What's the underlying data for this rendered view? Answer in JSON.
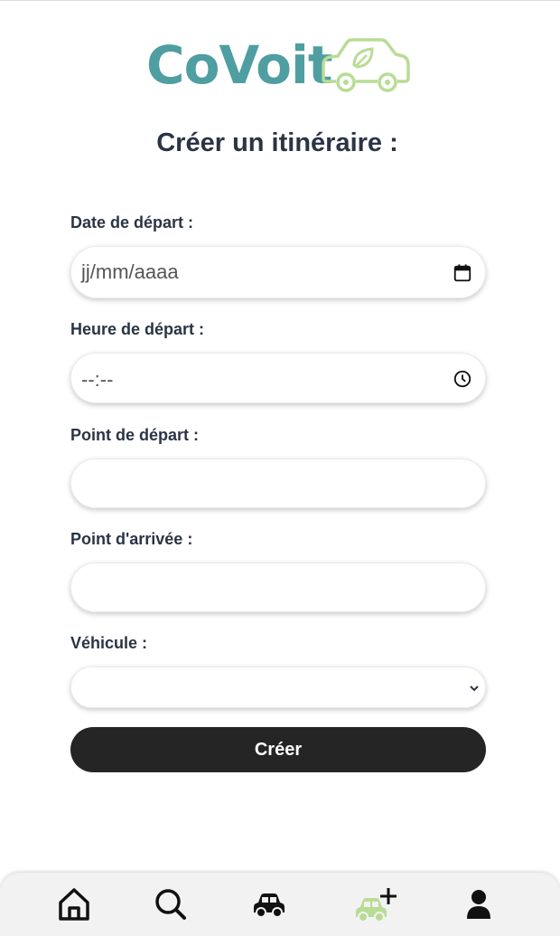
{
  "app": {
    "logo_text": "CoVoit"
  },
  "page": {
    "title": "Créer un itinéraire :"
  },
  "form": {
    "date": {
      "label": "Date de départ :",
      "placeholder": "jj/mm/aaaa"
    },
    "time": {
      "label": "Heure de départ :",
      "placeholder": "--:--"
    },
    "departure": {
      "label": "Point de départ :",
      "value": ""
    },
    "arrival": {
      "label": "Point d'arrivée :",
      "value": ""
    },
    "vehicle": {
      "label": "Véhicule :",
      "selected": ""
    },
    "submit_label": "Créer"
  },
  "nav": {
    "items": [
      {
        "name": "home",
        "icon": "home-icon",
        "active": false
      },
      {
        "name": "search",
        "icon": "search-icon",
        "active": false
      },
      {
        "name": "my-trips",
        "icon": "car-icon",
        "active": false
      },
      {
        "name": "create-trip",
        "icon": "car-plus-icon",
        "active": true
      },
      {
        "name": "profile",
        "icon": "user-icon",
        "active": false
      }
    ]
  },
  "colors": {
    "brand": "#4f9ea1",
    "brand_light": "#b9dc95",
    "text": "#2b3445",
    "button": "#252525",
    "nav_bg": "#f2f2f2"
  }
}
